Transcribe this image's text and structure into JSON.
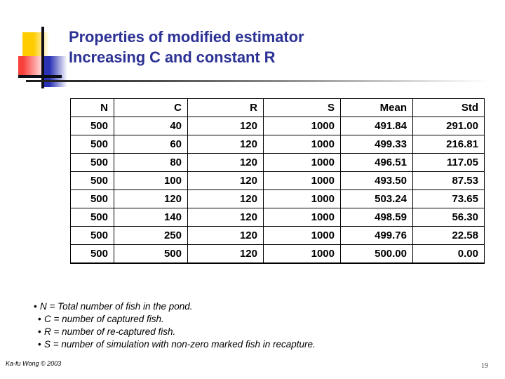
{
  "slide": {
    "title_line1": "Properties of modified estimator",
    "title_line2": "Increasing C and constant R",
    "title_color": "#2D3295"
  },
  "decoration": {
    "yellow": "#FFCC00",
    "red": "#F8403C",
    "blue": "#2B33B5",
    "line": "#0d0d17"
  },
  "chart_data": {
    "type": "table",
    "title": "Properties of modified estimator — Increasing C and constant R",
    "columns": [
      "N",
      "C",
      "R",
      "S",
      "Mean",
      "Std"
    ],
    "rows": [
      [
        "500",
        "40",
        "120",
        "1000",
        "491.84",
        "291.00"
      ],
      [
        "500",
        "60",
        "120",
        "1000",
        "499.33",
        "216.81"
      ],
      [
        "500",
        "80",
        "120",
        "1000",
        "496.51",
        "117.05"
      ],
      [
        "500",
        "100",
        "120",
        "1000",
        "493.50",
        "87.53"
      ],
      [
        "500",
        "120",
        "120",
        "1000",
        "503.24",
        "73.65"
      ],
      [
        "500",
        "140",
        "120",
        "1000",
        "498.59",
        "56.30"
      ],
      [
        "500",
        "250",
        "120",
        "1000",
        "499.76",
        "22.58"
      ],
      [
        "500",
        "500",
        "120",
        "1000",
        "500.00",
        "0.00"
      ]
    ]
  },
  "legend": {
    "items": [
      "N = Total number of fish in the pond.",
      "C = number of captured fish.",
      "R = number of re-captured fish.",
      "S = number of simulation with non-zero marked fish in recapture."
    ],
    "bullet_glyph": "•"
  },
  "footer": {
    "copyright": "Ka-fu Wong © 2003",
    "page_number": "19"
  }
}
